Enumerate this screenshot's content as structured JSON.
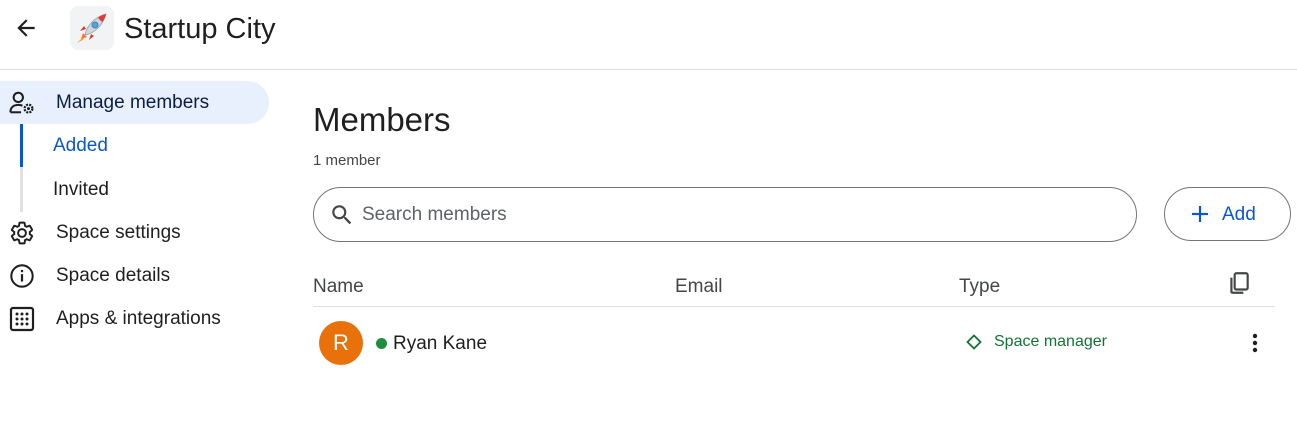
{
  "header": {
    "back_icon": "arrow-back-icon",
    "space_icon": "rocket-emoji-icon",
    "space_emoji": "🚀",
    "title": "Startup City"
  },
  "sidebar": {
    "items": [
      {
        "label": "Manage members",
        "icon": "manage-members-icon",
        "active": true
      },
      {
        "label": "Space settings",
        "icon": "gear-icon"
      },
      {
        "label": "Space details",
        "icon": "info-icon"
      },
      {
        "label": "Apps & integrations",
        "icon": "apps-grid-icon"
      }
    ],
    "sub_items": [
      {
        "label": "Added",
        "active": true
      },
      {
        "label": "Invited"
      }
    ]
  },
  "main": {
    "title": "Members",
    "member_count": "1 member",
    "search": {
      "placeholder": "Search members",
      "value": ""
    },
    "add_button": {
      "label": "Add"
    },
    "columns": {
      "name": "Name",
      "email": "Email",
      "type": "Type"
    },
    "rows": [
      {
        "avatar_letter": "R",
        "name": "Ryan Kane",
        "email": "",
        "type": "Space manager",
        "online": true
      }
    ]
  },
  "colors": {
    "accent": "#0b57d0",
    "active_nav_bg": "#e8f0fe",
    "avatar": "#e8710a",
    "presence": "#1e8e3e",
    "role": "#137333"
  }
}
